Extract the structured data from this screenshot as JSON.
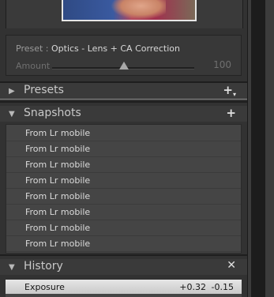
{
  "preset": {
    "label": "Preset : ",
    "value": "Optics - Lens + CA Correction",
    "amount_label": "Amount",
    "amount_value": "100",
    "amount_fraction": 1.0
  },
  "sections": {
    "presets": {
      "title": "Presets",
      "action_icon": "plus-dropdown-icon"
    },
    "snapshots": {
      "title": "Snapshots",
      "action_icon": "plus-icon"
    },
    "history": {
      "title": "History",
      "action_icon": "close-x-icon"
    }
  },
  "snapshots": [
    "From Lr mobile",
    "From Lr mobile",
    "From Lr mobile",
    "From Lr mobile",
    "From Lr mobile",
    "From Lr mobile",
    "From Lr mobile",
    "From Lr mobile"
  ],
  "history": [
    {
      "name": "Exposure",
      "change": "+0.32",
      "value": "-0.15"
    }
  ]
}
